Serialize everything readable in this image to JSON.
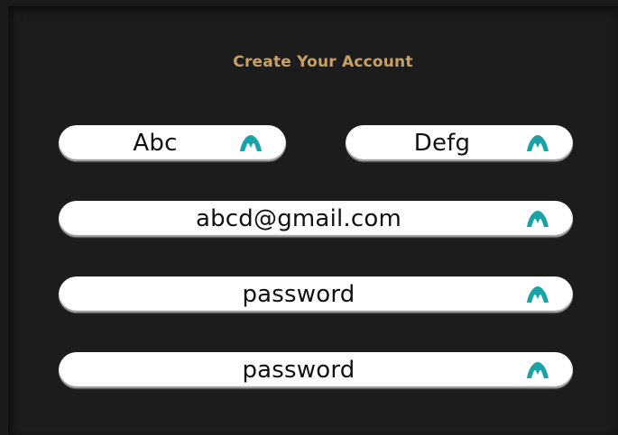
{
  "form": {
    "title": "Create Your Account",
    "first_name": {
      "value": "Abc"
    },
    "last_name": {
      "value": "Defg"
    },
    "email": {
      "value": "abcd@gmail.com"
    },
    "password": {
      "value": "password"
    },
    "confirm_password": {
      "value": "password"
    }
  },
  "icons": {
    "field_icon": "mountain-icon"
  },
  "colors": {
    "background": "#1c1c1c",
    "title": "#c9a063",
    "field_bg": "#ffffff",
    "icon": "#1aa3a6",
    "text": "#111111"
  }
}
